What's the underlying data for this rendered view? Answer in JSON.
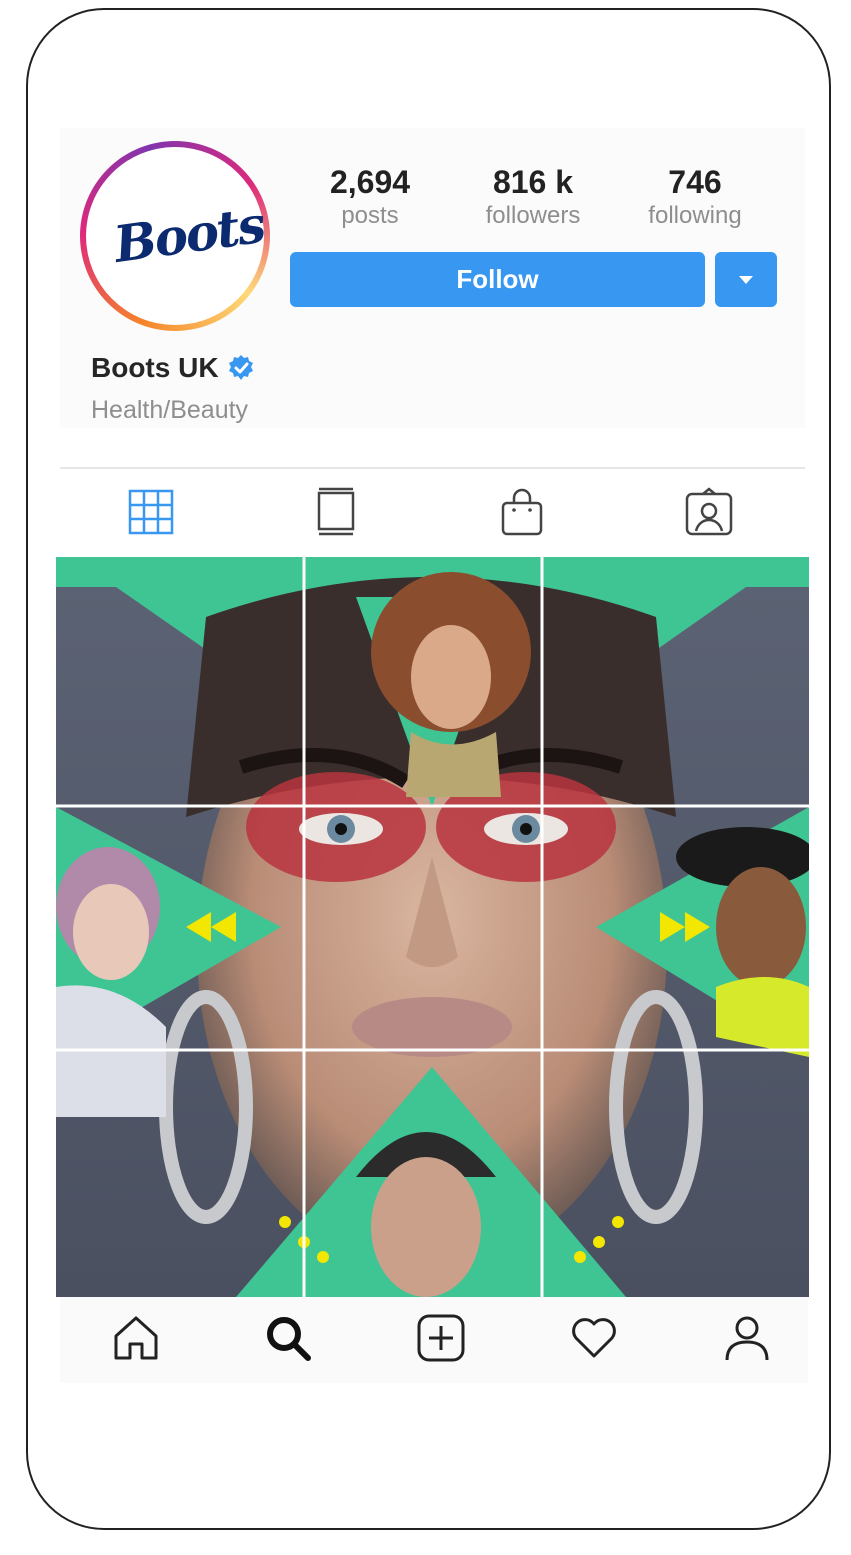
{
  "profile": {
    "logo_text": "Boots",
    "name": "Boots UK",
    "category": "Health/Beauty",
    "verified": true
  },
  "stats": [
    {
      "value": "2,694",
      "label": "posts"
    },
    {
      "value": "816 k",
      "label": "followers"
    },
    {
      "value": "746",
      "label": "following"
    }
  ],
  "actions": {
    "follow_label": "Follow"
  },
  "tabs": [
    {
      "icon": "grid-icon",
      "active": true
    },
    {
      "icon": "igtv-icon",
      "active": false
    },
    {
      "icon": "shopping-bag-icon",
      "active": false
    },
    {
      "icon": "tagged-icon",
      "active": false
    }
  ],
  "bottom_nav": [
    {
      "icon": "home-icon"
    },
    {
      "icon": "search-icon"
    },
    {
      "icon": "add-post-icon"
    },
    {
      "icon": "heart-icon"
    },
    {
      "icon": "profile-icon"
    }
  ],
  "colors": {
    "accent": "#3897f0",
    "teal": "#3fc494",
    "verified": "#3897f0"
  }
}
